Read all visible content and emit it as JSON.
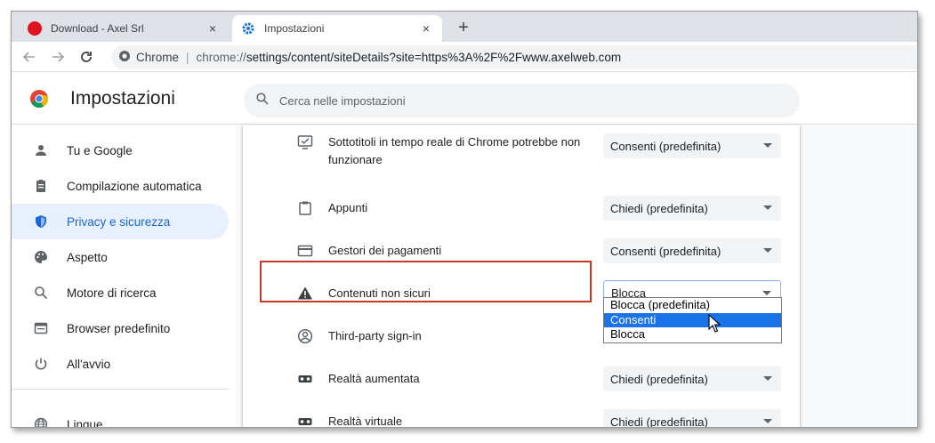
{
  "tabs": [
    {
      "label": "Download - Axel Srl",
      "close": "×"
    },
    {
      "label": "Impostazioni",
      "close": "×"
    }
  ],
  "new_tab": "+",
  "address": {
    "chip": "Chrome",
    "separator": "|",
    "scheme": "chrome://",
    "path": "settings/content/siteDetails?site=https%3A%2F%2Fwww.axelweb.com"
  },
  "header": {
    "title": "Impostazioni",
    "search_placeholder": "Cerca nelle impostazioni"
  },
  "sidebar": {
    "items": [
      {
        "label": "Tu e Google",
        "icon": "person-icon"
      },
      {
        "label": "Compilazione automatica",
        "icon": "clipboard-icon"
      },
      {
        "label": "Privacy e sicurezza",
        "icon": "shield-icon",
        "active": true
      },
      {
        "label": "Aspetto",
        "icon": "palette-icon"
      },
      {
        "label": "Motore di ricerca",
        "icon": "search-icon"
      },
      {
        "label": "Browser predefinito",
        "icon": "browser-icon"
      },
      {
        "label": "All'avvio",
        "icon": "power-icon"
      },
      {
        "label": "Lingue",
        "icon": "globe-icon"
      }
    ]
  },
  "permissions": [
    {
      "label": "Sottotitoli in tempo reale di Chrome potrebbe non funzionare",
      "value": "Consenti (predefinita)",
      "icon": "captions-icon"
    },
    {
      "label": "Appunti",
      "value": "Chiedi (predefinita)",
      "icon": "clipboard-paste-icon"
    },
    {
      "label": "Gestori dei pagamenti",
      "value": "Consenti (predefinita)",
      "icon": "credit-card-icon"
    },
    {
      "label": "Contenuti non sicuri",
      "value": "Blocca",
      "icon": "warning-icon"
    },
    {
      "label": "Third-party sign-in",
      "value": "",
      "icon": "account-circle-icon"
    },
    {
      "label": "Realtà aumentata",
      "value": "Chiedi (predefinita)",
      "icon": "vr-headset-icon"
    },
    {
      "label": "Realtà virtuale",
      "value": "Chiedi (predefinita)",
      "icon": "vr-headset-icon"
    }
  ],
  "dropdown": {
    "options": [
      "Blocca (predefinita)",
      "Consenti",
      "Blocca"
    ],
    "highlighted": "Consenti"
  },
  "colors": {
    "accent": "#1a73e8",
    "active_nav_bg": "#e8f0fe",
    "active_nav_text": "#1967d2",
    "highlight_border": "#c53929"
  }
}
